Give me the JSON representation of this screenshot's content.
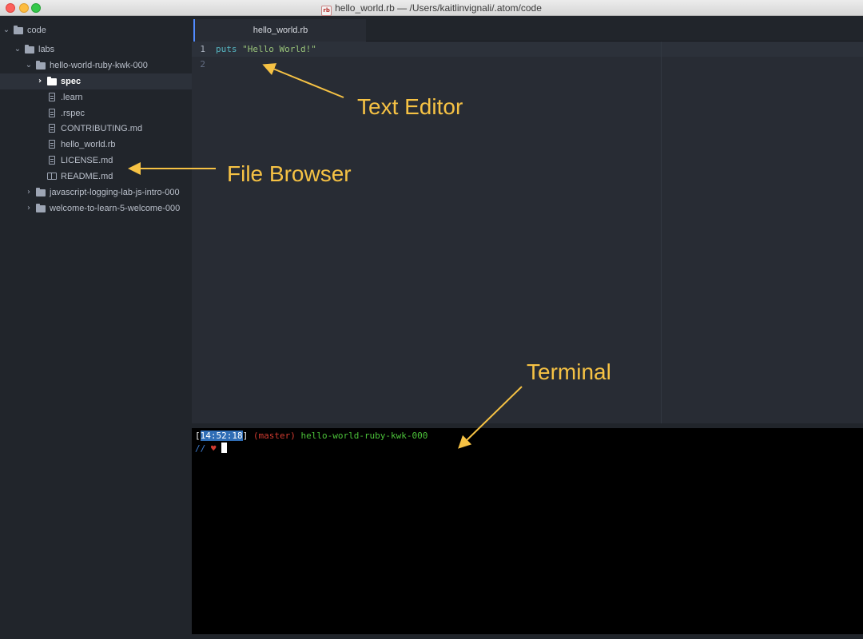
{
  "window": {
    "title": "hello_world.rb — /Users/kaitlinvignali/.atom/code",
    "file_icon_text": "rb"
  },
  "tree": [
    {
      "label": "code",
      "kind": "folder",
      "expanded": true,
      "depth": 0
    },
    {
      "label": "labs",
      "kind": "folder",
      "expanded": true,
      "depth": 1
    },
    {
      "label": "hello-world-ruby-kwk-000",
      "kind": "folder",
      "expanded": true,
      "depth": 2
    },
    {
      "label": "spec",
      "kind": "folder",
      "expanded": false,
      "depth": 3,
      "selected": true
    },
    {
      "label": ".learn",
      "kind": "file",
      "depth": 3
    },
    {
      "label": ".rspec",
      "kind": "file",
      "depth": 3
    },
    {
      "label": "CONTRIBUTING.md",
      "kind": "file",
      "depth": 3
    },
    {
      "label": "hello_world.rb",
      "kind": "file",
      "depth": 3
    },
    {
      "label": "LICENSE.md",
      "kind": "file",
      "depth": 3
    },
    {
      "label": "README.md",
      "kind": "book",
      "depth": 3
    },
    {
      "label": "javascript-logging-lab-js-intro-000",
      "kind": "folder",
      "expanded": false,
      "depth": 2
    },
    {
      "label": "welcome-to-learn-5-welcome-000",
      "kind": "folder",
      "expanded": false,
      "depth": 2
    }
  ],
  "tab": {
    "label": "hello_world.rb"
  },
  "editor": {
    "lines": [
      {
        "number": "1",
        "keyword": "puts",
        "string": "\"Hello World!\""
      },
      {
        "number": "2",
        "keyword": "",
        "string": ""
      }
    ]
  },
  "terminal": {
    "time": "14:52:18",
    "branch": "(master)",
    "directory": "hello-world-ruby-kwk-000",
    "prompt": "//",
    "heart": "♥"
  },
  "annotations": {
    "text_editor": "Text Editor",
    "file_browser": "File Browser",
    "terminal": "Terminal"
  },
  "colors": {
    "annotation": "#f6c244",
    "accent": "#528bff",
    "sidebar_bg": "#21252b",
    "editor_bg": "#282c34",
    "terminal_bg": "#000000"
  }
}
